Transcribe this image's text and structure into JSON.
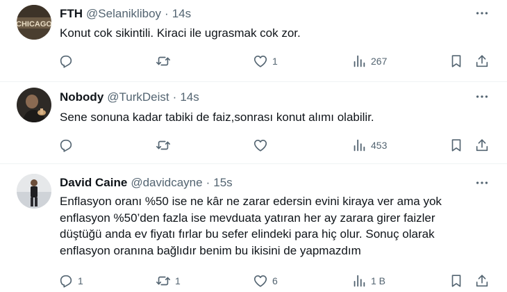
{
  "tweets": [
    {
      "name": "FTH",
      "handle": "@Selanikliboy",
      "separator": "·",
      "time": "14s",
      "text": "Konut cok sikintili. Kiraci ile ugrasmak cok zor.",
      "replies": "",
      "retweets": "",
      "likes": "1",
      "views": "267",
      "avatar_label": "CHICAGO"
    },
    {
      "name": "Nobody",
      "handle": "@TurkDeist",
      "separator": "·",
      "time": "14s",
      "text": "Sene sonuna kadar tabiki de faiz,sonrası konut alımı olabilir.",
      "replies": "",
      "retweets": "",
      "likes": "",
      "views": "453"
    },
    {
      "name": "David Caine",
      "handle": "@davidcayne",
      "separator": "·",
      "time": "15s",
      "text_lines": [
        "Enflasyon oranı %50 ise ne kâr ne zarar edersin evini kiraya ver ama yok",
        "enflasyon %50’den fazla ise mevduata yatıran her ay zarara girer faizler",
        "düştüğü anda ev fiyatı fırlar bu sefer elindeki para hiç olur. Sonuç olarak",
        "enflasyon oranına bağlıdır benim bu ikisini de yapmazdım"
      ],
      "replies": "1",
      "retweets": "1",
      "likes": "6",
      "views": "1 B"
    }
  ]
}
